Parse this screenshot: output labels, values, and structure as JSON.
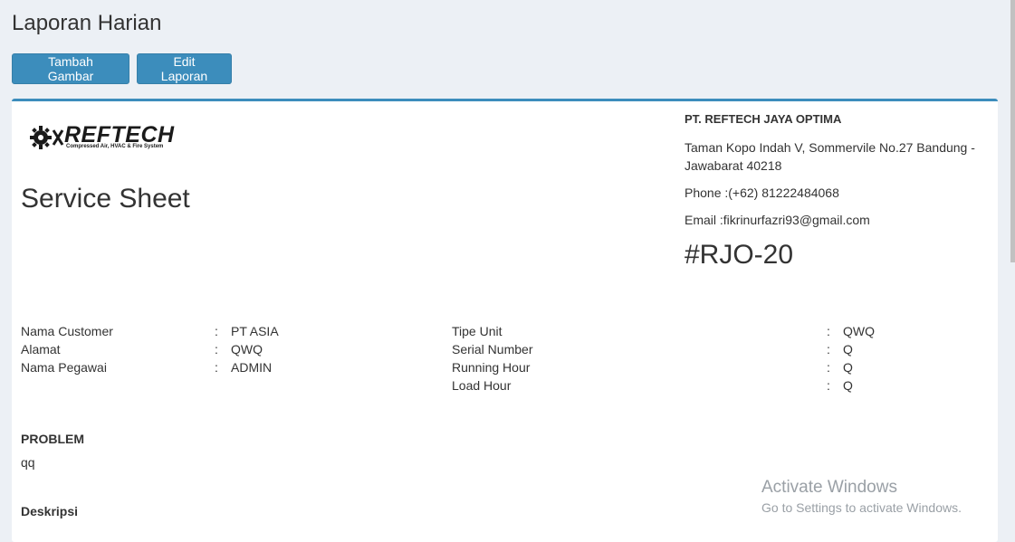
{
  "page": {
    "title": "Laporan Harian"
  },
  "toolbar": {
    "add_image_label": "Tambah Gambar",
    "edit_report_label": "Edit Laporan"
  },
  "logo": {
    "brand": "REFTECH",
    "tagline": "Compressed Air, HVAC & Fire System"
  },
  "sheet": {
    "title": "Service Sheet"
  },
  "company": {
    "name": "PT. REFTECH JAYA OPTIMA",
    "address": "Taman Kopo Indah V, Sommervile No.27 Bandung - Jawabarat 40218",
    "phone": "Phone :(+62) 81222484068",
    "email": "Email :fikrinurfazri93@gmail.com",
    "job_number": "#RJO-20"
  },
  "info_left": [
    {
      "label": "Nama Customer",
      "sep": ":",
      "value": "PT ASIA"
    },
    {
      "label": "Alamat",
      "sep": ":",
      "value": "QWQ"
    },
    {
      "label": "Nama Pegawai",
      "sep": ":",
      "value": "ADMIN"
    }
  ],
  "info_right": [
    {
      "label": "Tipe Unit",
      "sep": ":",
      "value": "QWQ"
    },
    {
      "label": "Serial Number",
      "sep": ":",
      "value": "Q"
    },
    {
      "label": "Running Hour",
      "sep": ":",
      "value": "Q"
    },
    {
      "label": "Load Hour",
      "sep": ":",
      "value": "Q"
    }
  ],
  "problem": {
    "title": "PROBLEM",
    "text": "qq"
  },
  "description": {
    "title": "Deskripsi"
  },
  "watermark": {
    "title": "Activate Windows",
    "subtitle": "Go to Settings to activate Windows."
  }
}
